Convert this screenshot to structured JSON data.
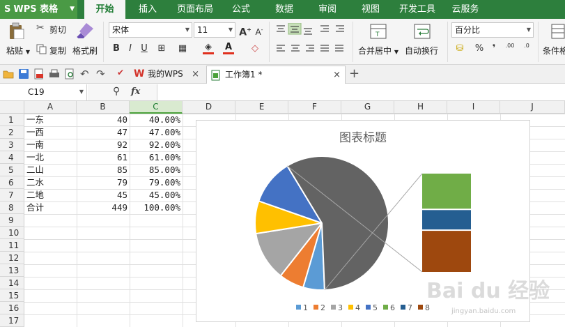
{
  "app": {
    "name": "WPS 表格",
    "logo": "S"
  },
  "menus": [
    "开始",
    "插入",
    "页面布局",
    "公式",
    "数据",
    "审阅",
    "视图",
    "开发工具",
    "云服务"
  ],
  "ribbon": {
    "paste": "粘贴",
    "cut": "剪切",
    "copy": "复制",
    "format_painter": "格式刷",
    "font_name": "宋体",
    "font_size": "11",
    "merge_center": "合并居中",
    "wrap_text": "自动换行",
    "number_format": "百分比",
    "conditional_format": "条件格",
    "grow_font": "A",
    "shrink_font": "A",
    "bold": "B",
    "italic": "I",
    "underline": "U",
    "font_color": "A",
    "percent": "%",
    "thousands": "❜",
    "inc_decimal": ".00",
    "dec_decimal": ".0"
  },
  "tabs": [
    {
      "label": "我的WPS",
      "close": "×"
    },
    {
      "label": "工作簿1 *",
      "close": "×"
    }
  ],
  "new_tab": "+",
  "formula_bar": {
    "cell_ref": "C19",
    "fx": "fx",
    "zoom_icon": "⚲"
  },
  "columns": [
    "A",
    "B",
    "C",
    "D",
    "E",
    "F",
    "G",
    "H",
    "I",
    "J"
  ],
  "rows": [
    "1",
    "2",
    "3",
    "4",
    "5",
    "6",
    "7",
    "8",
    "9",
    "10",
    "11",
    "12",
    "13",
    "14",
    "15",
    "16",
    "17"
  ],
  "table": [
    [
      "一东",
      "40",
      "40.00%"
    ],
    [
      "一西",
      "47",
      "47.00%"
    ],
    [
      "一南",
      "92",
      "92.00%"
    ],
    [
      "一北",
      "61",
      "61.00%"
    ],
    [
      "二山",
      "85",
      "85.00%"
    ],
    [
      "二水",
      "79",
      "79.00%"
    ],
    [
      "二地",
      "45",
      "45.00%"
    ],
    [
      "合计",
      "449",
      "100.00%"
    ]
  ],
  "chart_data": {
    "type": "pie",
    "subtype": "bar-of-pie",
    "title": "图表标题",
    "categories": [
      "1",
      "2",
      "3",
      "4",
      "5",
      "6",
      "7",
      "8"
    ],
    "values": [
      40,
      47,
      92,
      61,
      85,
      79,
      45,
      449
    ],
    "pie_slices": [
      40,
      47,
      92,
      61,
      85,
      449
    ],
    "secondary_bar": [
      79,
      45,
      92
    ],
    "colors": [
      "#5b9bd5",
      "#ed7d31",
      "#a5a5a5",
      "#ffc000",
      "#4472c4",
      "#70ad47",
      "#255e91",
      "#9e480e"
    ],
    "legend_position": "bottom"
  },
  "watermark": {
    "text": "Bai du 经验",
    "sub": "jingyan.baidu.com"
  }
}
